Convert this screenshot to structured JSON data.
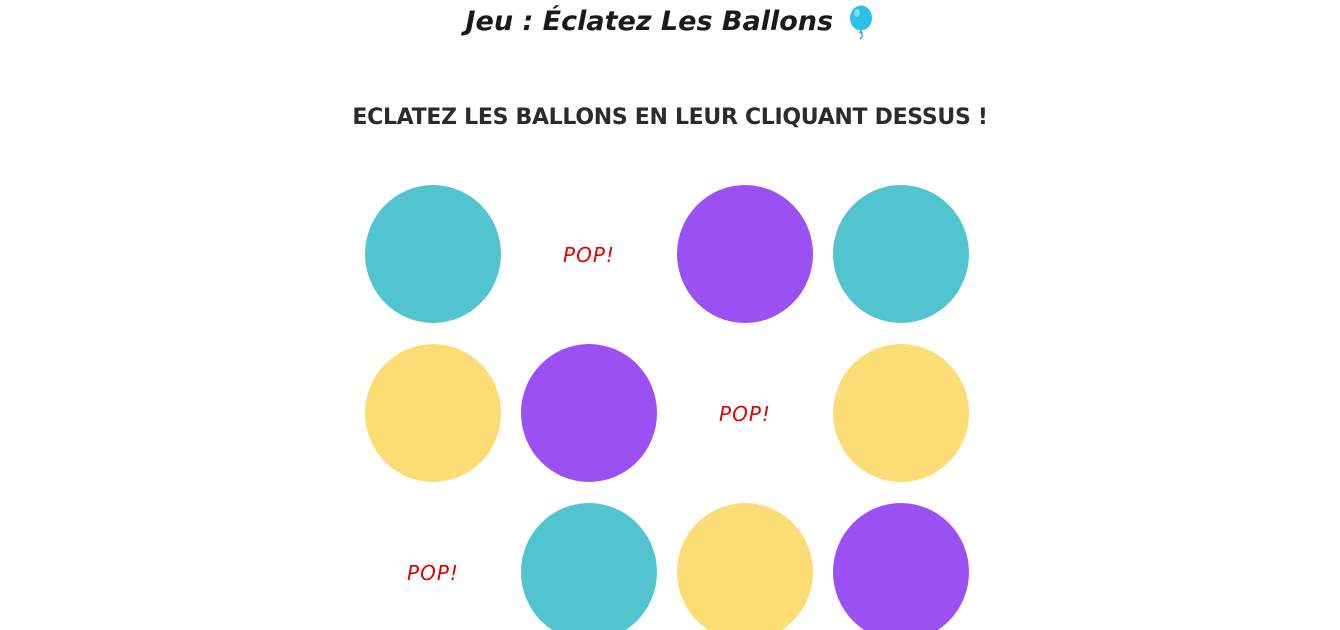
{
  "header": {
    "title": "Jeu : Éclatez Les Ballons",
    "title_icon": "balloon-icon"
  },
  "instructions": "ECLATEZ LES BALLONS EN LEUR CLIQUANT DESSUS !",
  "colors": {
    "teal": "#52c4cf",
    "purple": "#9a50f3",
    "yellow": "#fcdc74",
    "pop_text": "#e00000",
    "balloon_icon": "#29c1ea"
  },
  "grid": {
    "rows": [
      [
        {
          "state": "balloon",
          "color": "teal"
        },
        {
          "state": "popped",
          "label": "POP!"
        },
        {
          "state": "balloon",
          "color": "purple"
        },
        {
          "state": "balloon",
          "color": "teal"
        }
      ],
      [
        {
          "state": "balloon",
          "color": "yellow"
        },
        {
          "state": "balloon",
          "color": "purple"
        },
        {
          "state": "popped",
          "label": "POP!"
        },
        {
          "state": "balloon",
          "color": "yellow"
        }
      ],
      [
        {
          "state": "popped",
          "label": "POP!"
        },
        {
          "state": "balloon",
          "color": "teal"
        },
        {
          "state": "balloon",
          "color": "yellow"
        },
        {
          "state": "balloon",
          "color": "purple"
        }
      ]
    ]
  }
}
